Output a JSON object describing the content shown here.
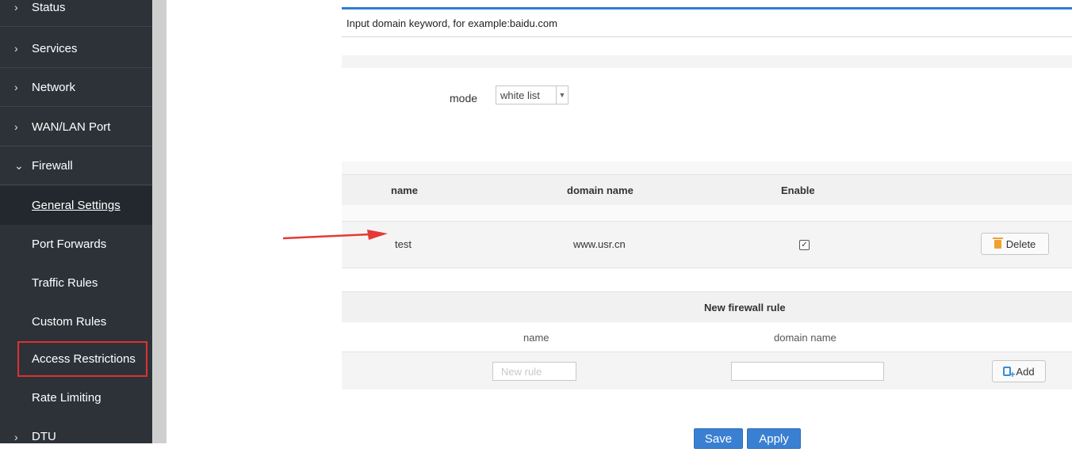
{
  "sidebar": {
    "items": [
      {
        "label": "Status",
        "chevron": "›"
      },
      {
        "label": "Services",
        "chevron": "›"
      },
      {
        "label": "Network",
        "chevron": "›"
      },
      {
        "label": "WAN/LAN Port",
        "chevron": "›"
      },
      {
        "label": "Firewall",
        "chevron": "⌄"
      }
    ],
    "subitems": [
      {
        "label": "General Settings"
      },
      {
        "label": "Port Forwards"
      },
      {
        "label": "Traffic Rules"
      },
      {
        "label": "Custom Rules"
      },
      {
        "label": "Access Restrictions"
      },
      {
        "label": "Rate Limiting"
      }
    ],
    "last_item": {
      "label": "DTU",
      "chevron": "›"
    }
  },
  "main": {
    "domain_hint": "Input domain keyword, for example:baidu.com",
    "mode_label": "mode",
    "mode_value": "white list",
    "rules_table": {
      "headers": [
        "name",
        "domain name",
        "Enable"
      ],
      "rows": [
        {
          "name": "test",
          "domain": "www.usr.cn",
          "enabled_mark": "✓",
          "delete_label": "Delete"
        }
      ]
    },
    "new_rule": {
      "title": "New firewall rule",
      "col_name": "name",
      "col_domain": "domain name",
      "name_placeholder": "New rule",
      "add_label": "Add"
    },
    "save_label": "Save",
    "apply_label": "Apply"
  },
  "colors": {
    "sidebar_bg": "#2d3239",
    "accent": "#3a80d2",
    "highlight_border": "#e0302e",
    "annotation_arrow": "#e53935"
  }
}
